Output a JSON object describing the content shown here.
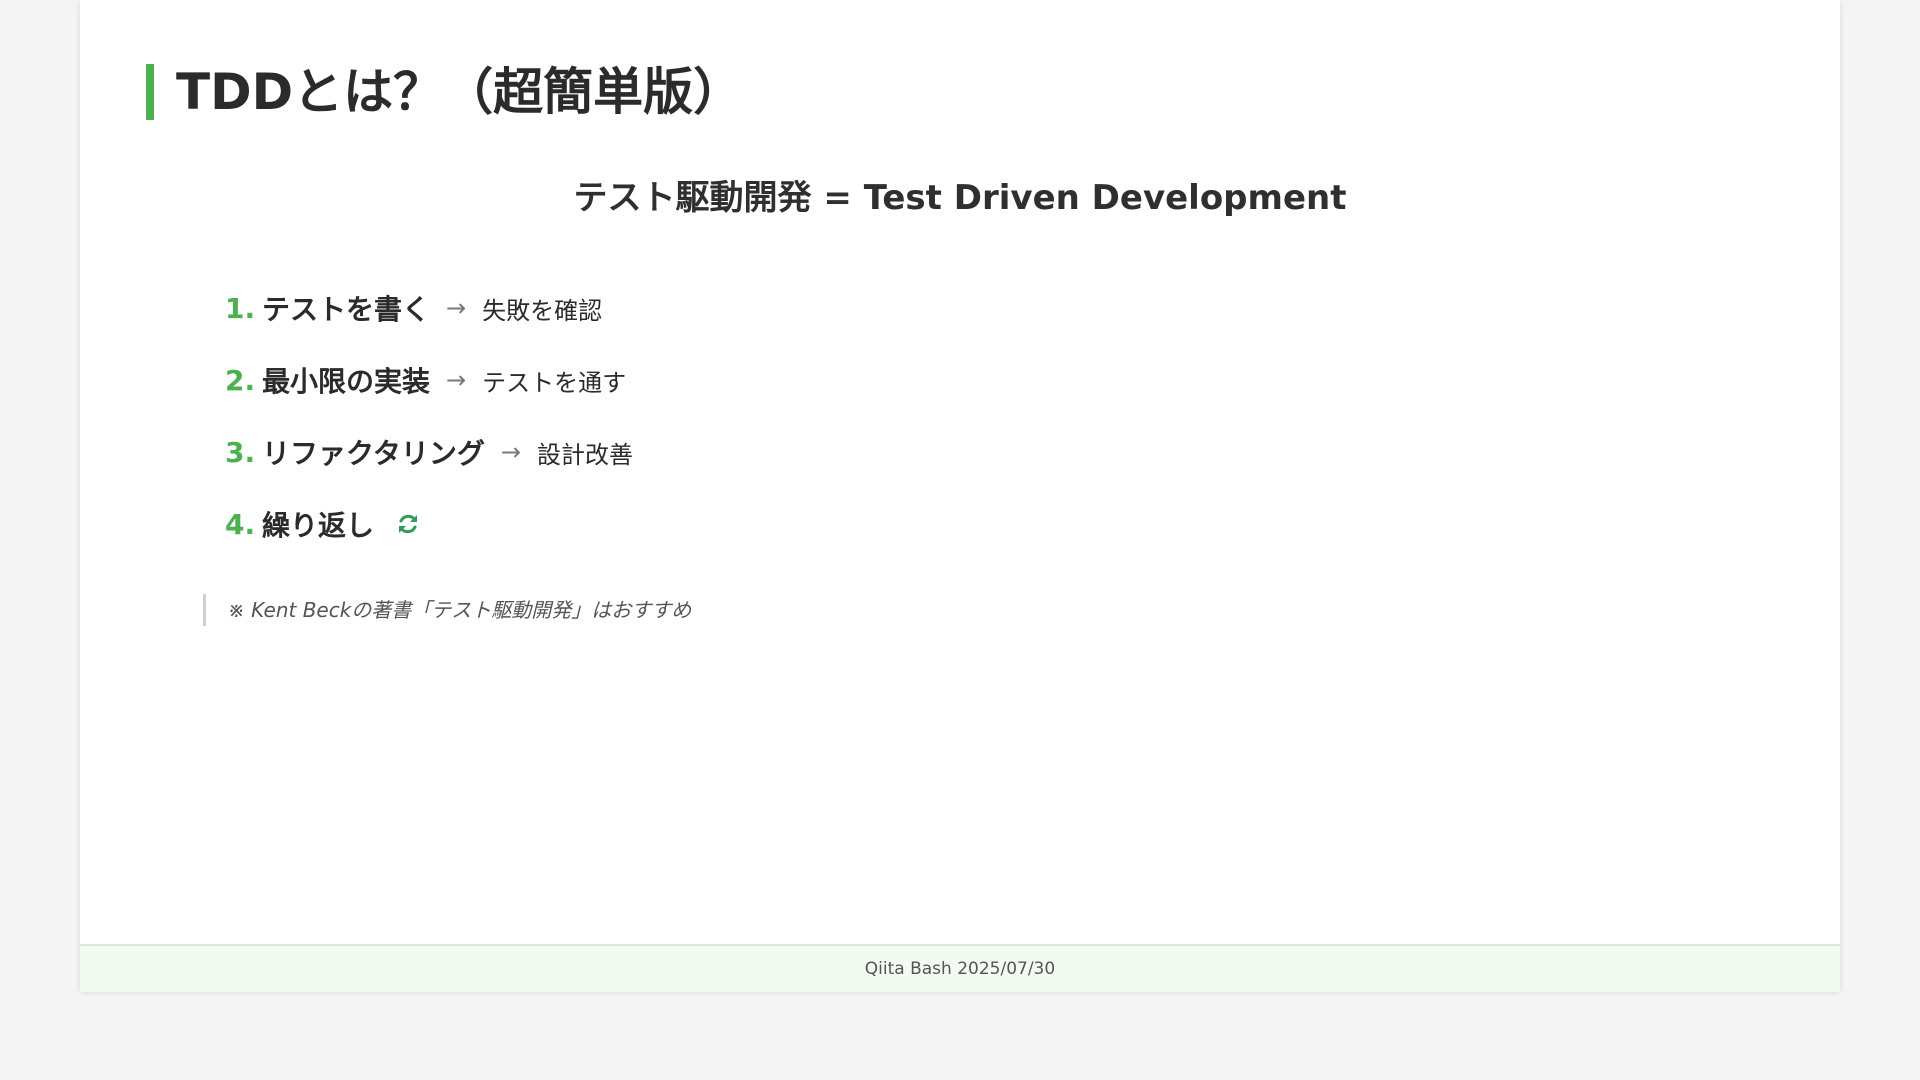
{
  "slide": {
    "title": "TDDとは？（超簡単版）",
    "subtitle": "テスト駆動開発 = Test Driven Development",
    "steps": [
      {
        "num": "1.",
        "label": "テストを書く",
        "arrow": "→",
        "result": "失敗を確認"
      },
      {
        "num": "2.",
        "label": "最小限の実装",
        "arrow": "→",
        "result": "テストを通す"
      },
      {
        "num": "3.",
        "label": "リファクタリング",
        "arrow": "→",
        "result": "設計改善"
      },
      {
        "num": "4.",
        "label": "繰り返し",
        "icon": "refresh-icon"
      }
    ],
    "note": "※ Kent Beckの著書「テスト駆動開発」はおすすめ",
    "footer": "Qiita Bash 2025/07/30"
  },
  "colors": {
    "accent": "#4caf50",
    "refresh_icon": "#2e9c5a",
    "text": "#2b2b2b",
    "background": "#f4f4f4",
    "footer_bg": "#f3faf2"
  }
}
